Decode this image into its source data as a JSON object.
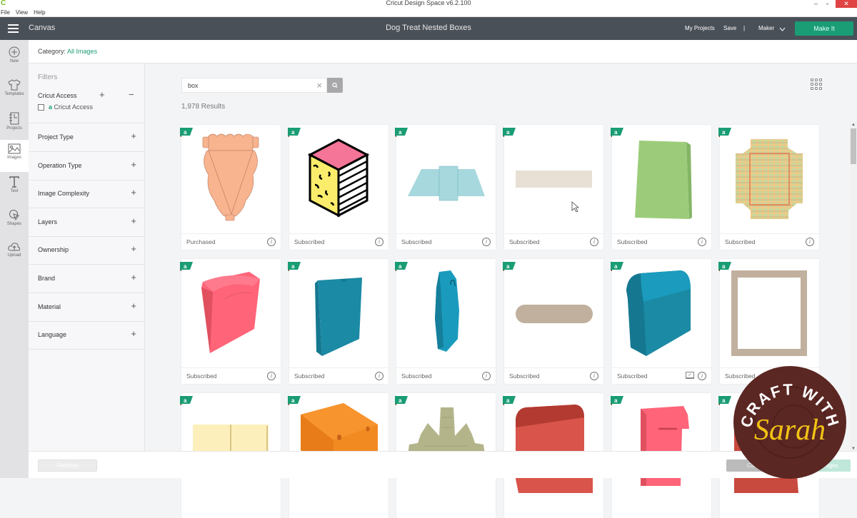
{
  "window": {
    "title": "Cricut Design Space  v6.2.100",
    "minimize": "–",
    "restore": "▫",
    "close": "✕"
  },
  "menu": [
    "File",
    "View",
    "Help"
  ],
  "header": {
    "section": "Canvas",
    "project_title": "Dog Treat Nested Boxes",
    "my_projects": "My Projects",
    "save": "Save",
    "separator": "|",
    "machine": "Maker",
    "make_it": "Make It"
  },
  "leftnav": [
    {
      "label": "New",
      "icon": "plus-circle-icon"
    },
    {
      "label": "Templates",
      "icon": "tshirt-icon"
    },
    {
      "label": "Projects",
      "icon": "notebook-icon"
    },
    {
      "label": "Images",
      "icon": "image-icon",
      "active": true
    },
    {
      "label": "Text",
      "icon": "text-icon"
    },
    {
      "label": "Shapes",
      "icon": "shapes-icon"
    },
    {
      "label": "Upload",
      "icon": "upload-cloud-icon"
    }
  ],
  "category": {
    "label": "Category:",
    "value": "All Images"
  },
  "filters": {
    "title": "Filters",
    "cricut_access": {
      "name": "Cricut Access",
      "plus": "+",
      "minus": "−",
      "checkbox_label": "Cricut Access",
      "checked": false
    },
    "sections": [
      {
        "name": "Project Type"
      },
      {
        "name": "Operation Type"
      },
      {
        "name": "Image Complexity"
      },
      {
        "name": "Layers"
      },
      {
        "name": "Ownership"
      },
      {
        "name": "Brand"
      },
      {
        "name": "Material"
      },
      {
        "name": "Language"
      }
    ],
    "plus": "+"
  },
  "search": {
    "value": "box",
    "clear": "×"
  },
  "results": "1,978 Results",
  "cards": [
    {
      "status": "Purchased",
      "shape": "pennant-box"
    },
    {
      "status": "Subscribed",
      "shape": "memphis-cube"
    },
    {
      "status": "Subscribed",
      "shape": "blue-tray"
    },
    {
      "status": "Subscribed",
      "shape": "beige-strip"
    },
    {
      "status": "Subscribed",
      "shape": "green-box"
    },
    {
      "status": "Subscribed",
      "shape": "plaid-box"
    },
    {
      "status": "Subscribed",
      "shape": "pink-pouch"
    },
    {
      "status": "Subscribed",
      "shape": "teal-box"
    },
    {
      "status": "Subscribed",
      "shape": "teal-tall-box"
    },
    {
      "status": "Subscribed",
      "shape": "tan-pill"
    },
    {
      "status": "Subscribed",
      "shape": "treasure-chest",
      "laptop": true
    },
    {
      "status": "Subscribed",
      "shape": "tan-frame"
    },
    {
      "status": "",
      "shape": "cream-box"
    },
    {
      "status": "",
      "shape": "orange-box"
    },
    {
      "status": "",
      "shape": "sage-net"
    },
    {
      "status": "",
      "shape": "red-box"
    },
    {
      "status": "",
      "shape": "pink-mailbox"
    },
    {
      "status": "",
      "shape": "rust-box"
    }
  ],
  "bottom": {
    "remove": "Remove",
    "cancel": "Cancel",
    "insert": "Insert Images"
  },
  "watermark": {
    "top": "CRAFT WITH",
    "script": "Sarah"
  },
  "colors": {
    "accent": "#1a9c74",
    "header": "#4a5058",
    "badge": "#1a9c74",
    "watermark": "#5b2723",
    "watermark_text": "#f2c315"
  }
}
